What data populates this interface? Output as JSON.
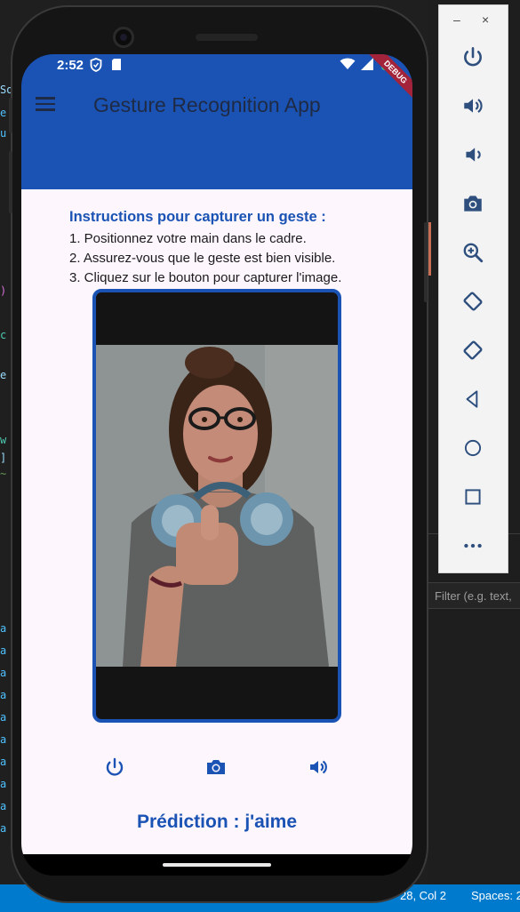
{
  "ide": {
    "filter_placeholder": "Filter (e.g. text,",
    "status_position": "28, Col 2",
    "status_spaces": "Spaces: 2",
    "left_gutter_chars": [
      "So",
      "e",
      "u",
      ")",
      "c",
      "e",
      "w",
      "]",
      "~",
      "a",
      "a",
      "a",
      "a",
      "a",
      "a",
      "a",
      "a",
      "a",
      "a"
    ]
  },
  "emulator_toolbar": {
    "minimize": "–",
    "close": "×",
    "tools": [
      "power-icon",
      "volume-up-icon",
      "volume-down-icon",
      "camera-icon",
      "zoom-icon",
      "rotate-left-icon",
      "rotate-right-icon",
      "back-icon",
      "home-icon",
      "overview-icon",
      "more-icon"
    ]
  },
  "status_bar": {
    "time": "2:52",
    "debug_label": "DEBUG"
  },
  "app_bar": {
    "title": "Gesture Recognition App"
  },
  "instructions": {
    "title": "Instructions pour capturer un geste :",
    "steps": [
      "1. Positionnez votre main dans le cadre.",
      "2. Assurez-vous que le geste est bien visible.",
      "3. Cliquez sur le bouton pour capturer l'image."
    ]
  },
  "actions": {
    "icons": [
      "power-icon",
      "camera-icon",
      "volume-icon"
    ]
  },
  "prediction": {
    "text": "Prédiction : j'aime"
  },
  "colors": {
    "primary": "#1a53b4",
    "background": "#fdf6fd",
    "statusbar": "#007acc"
  }
}
